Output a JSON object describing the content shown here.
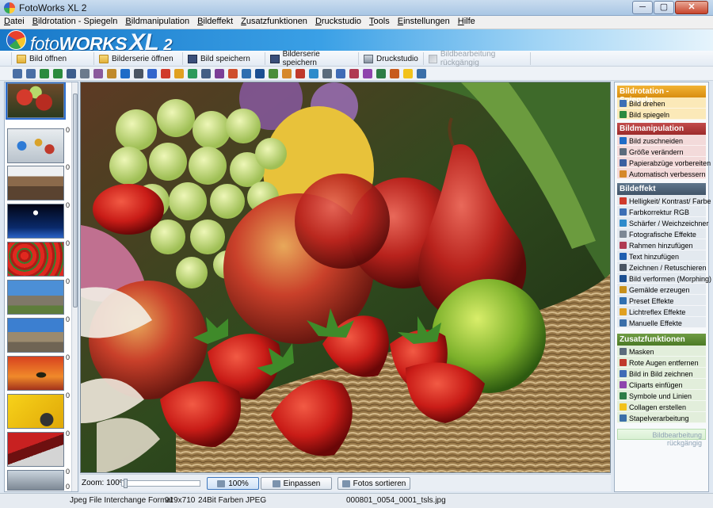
{
  "window": {
    "title": "FotoWorks XL 2",
    "minimize": "─",
    "maximize": "▢",
    "close": "✕"
  },
  "menu": [
    {
      "pre": "",
      "key": "D",
      "rest": "atei"
    },
    {
      "pre": "",
      "key": "B",
      "rest": "ildrotation - Spiegeln"
    },
    {
      "pre": "",
      "key": "B",
      "rest": "ildmanipulation"
    },
    {
      "pre": "",
      "key": "B",
      "rest": "ildeffekt"
    },
    {
      "pre": "",
      "key": "Z",
      "rest": "usatzfunktionen"
    },
    {
      "pre": "",
      "key": "D",
      "rest": "ruckstudio"
    },
    {
      "pre": "",
      "key": "T",
      "rest": "ools"
    },
    {
      "pre": "",
      "key": "E",
      "rest": "instellungen"
    },
    {
      "pre": "",
      "key": "H",
      "rest": "ilfe"
    }
  ],
  "banner": {
    "logo_foto": "foto",
    "logo_works": "WORKS",
    "logo_xl": "XL",
    "logo_version": "2"
  },
  "actions": [
    {
      "label": "Bild öffnen",
      "icon": "folder-icon"
    },
    {
      "label": "Bilderserie öffnen",
      "icon": "folder-icon"
    },
    {
      "label": "Bild speichern",
      "icon": "disk-icon"
    },
    {
      "label": "Bilderserie speichern",
      "icon": "disk-icon"
    },
    {
      "label": "Druckstudio",
      "icon": "printer-icon"
    },
    {
      "label": "Bildbearbeitung rückgängig",
      "icon": "magic-wand-icon",
      "disabled": true
    }
  ],
  "thumbnails": {
    "numbers": [
      "0",
      "0",
      "0",
      "0",
      "0",
      "0",
      "0",
      "0",
      "0",
      "0",
      "0"
    ]
  },
  "zoom": {
    "label": "Zoom: 100%",
    "fit_label": "100%",
    "fit_window_label": "Einpassen",
    "sort_label": "Fotos sortieren",
    "level": 0.02
  },
  "panel": {
    "rotation": {
      "title": "Bildrotation - Spiegeln",
      "color": "#e8a21d",
      "items": [
        "Bild drehen",
        "Bild spiegeln"
      ]
    },
    "manipulation": {
      "title": "Bildmanipulation",
      "color": "#b23a3a",
      "items": [
        "Bild zuschneiden",
        "Größe verändern",
        "Papierabzüge vorbereiten",
        "Automatisch verbessern"
      ]
    },
    "effect": {
      "title": "Bildeffekt",
      "color": "#4e6478",
      "items": [
        "Helligkeit/ Kontrast/ Farbe",
        "Farbkorrektur RGB",
        "Schärfer / Weichzeichner",
        "Fotografische Effekte",
        "Rahmen hinzufügen",
        "Text hinzufügen",
        "Zeichnen / Retuschieren",
        "Bild verformen (Morphing)",
        "Gemälde erzeugen",
        "Preset Effekte",
        "Lichtreflex Effekte",
        "Manuelle Effekte"
      ]
    },
    "extra": {
      "title": "Zusatzfunktionen",
      "color": "#5f8a3a",
      "items": [
        "Masken",
        "Rote Augen entfernen",
        "Bild in Bild zeichnen",
        "Cliparts einfügen",
        "Symbole und Linien",
        "Collagen erstellen",
        "Stapelverarbeitung"
      ]
    },
    "undo": "Bildbearbeitung rückgängig"
  },
  "status": {
    "format": "Jpeg File Interchange Format",
    "dimensions": "919x710",
    "bits": "24Bit Farben",
    "type": "JPEG",
    "filename": "000801_0054_0001_tsls.jpg"
  }
}
